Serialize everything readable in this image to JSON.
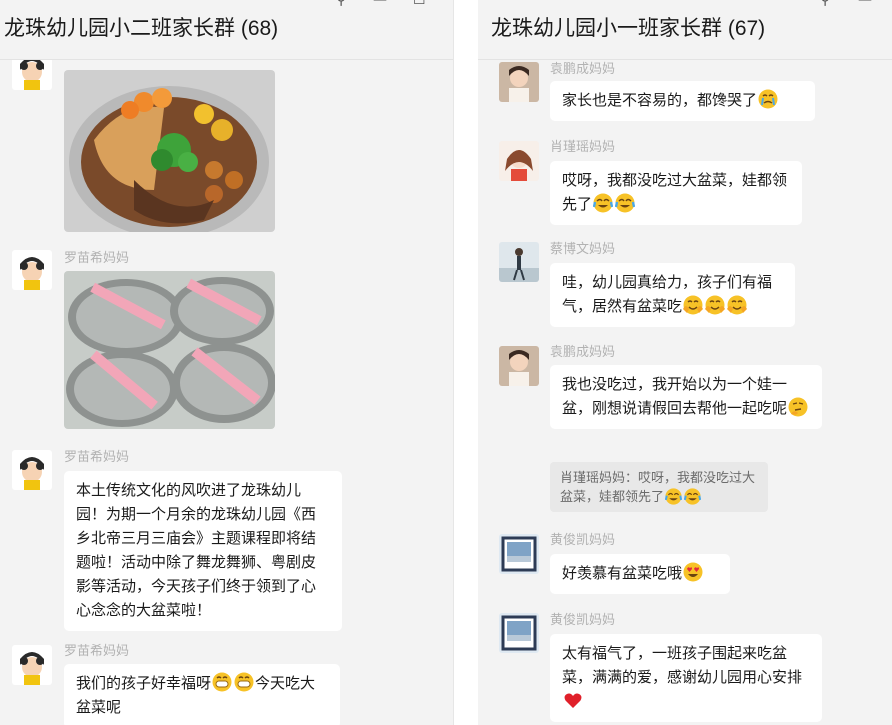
{
  "left_chat": {
    "title": "龙珠幼儿园小二班家长群 (68)",
    "messages": [
      {
        "sender": "罗苗希妈妈"
      },
      {
        "sender": "罗苗希妈妈"
      },
      {
        "sender": "罗苗希妈妈",
        "text": "本土传统文化的风吹进了龙珠幼儿园！为期一个月余的龙珠幼儿园《西乡北帝三月三庙会》主题课程即将结题啦！活动中除了舞龙舞狮、粤剧皮影等活动，今天孩子们终于领到了心心念念的大盆菜啦！"
      },
      {
        "sender": "罗苗希妈妈",
        "text_a": "我们的孩子好幸福呀",
        "text_b": "今天吃大盆菜呢"
      }
    ]
  },
  "right_chat": {
    "title": "龙珠幼儿园小一班家长群 (67)",
    "messages": [
      {
        "sender": "袁鹏成妈妈",
        "text": "家长也是不容易的，都馋哭了"
      },
      {
        "sender": "肖瑾瑶妈妈",
        "text": "哎呀，我都没吃过大盆菜，娃都领先了"
      },
      {
        "sender": "蔡博文妈妈",
        "text": "哇，幼儿园真给力，孩子们有福气，居然有盆菜吃"
      },
      {
        "sender": "袁鹏成妈妈",
        "text": "我也没吃过，我开始以为一个娃一盆，刚想说请假回去帮他一起吃呢",
        "quote": "肖瑾瑶妈妈：哎呀，我都没吃过大盆菜，娃都领先了"
      },
      {
        "sender": "黄俊凯妈妈",
        "text": "好羡慕有盆菜吃哦"
      },
      {
        "sender": "黄俊凯妈妈",
        "text": "太有福气了，一班孩子围起来吃盆菜，满满的爱，感谢幼儿园用心安排"
      }
    ]
  },
  "window_controls": {
    "pin": "⚲",
    "minimize": "—",
    "maximize": "☐"
  },
  "colors": {
    "panel_bg": "#f3f3f3",
    "bubble_bg": "#ffffff",
    "sender_text": "#b2b2b2",
    "heart": "#e0202a"
  }
}
